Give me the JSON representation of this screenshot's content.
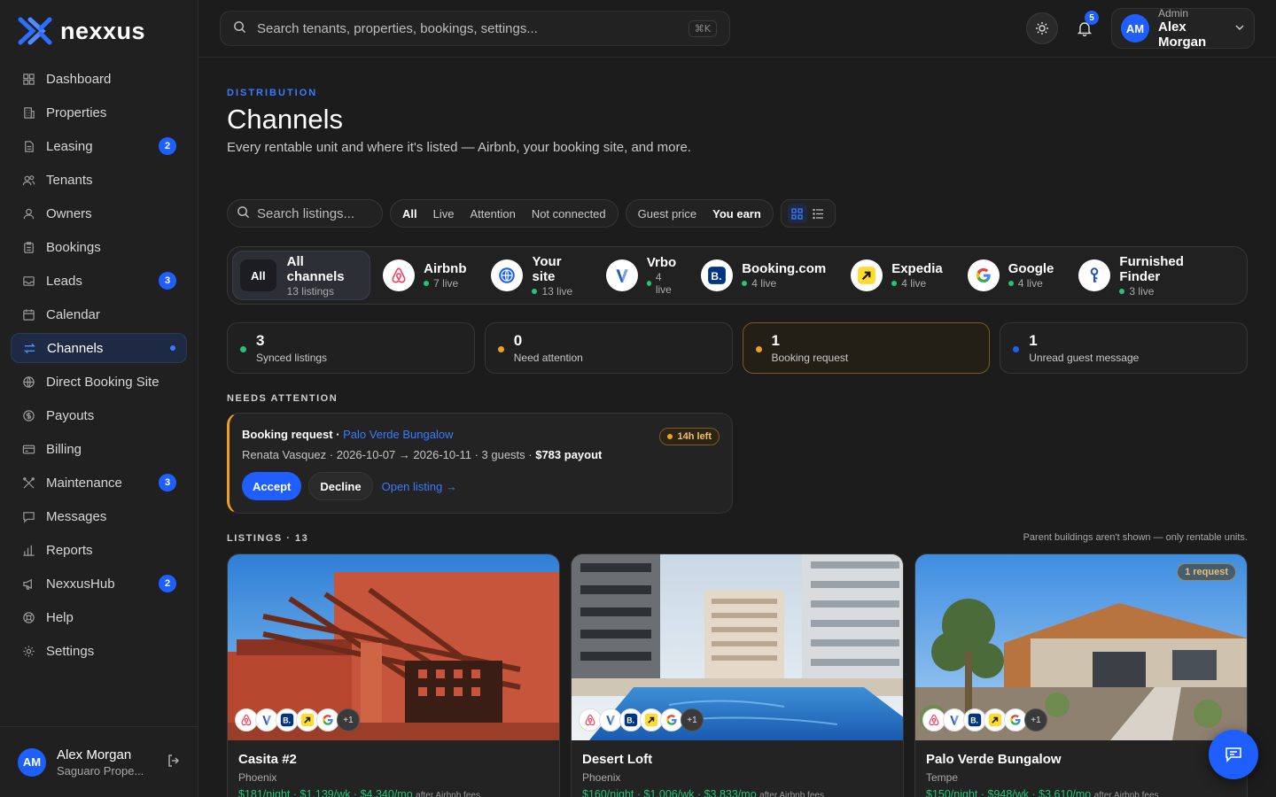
{
  "brand": {
    "name": "nexxus",
    "accent": "#1f5fff"
  },
  "sidebar": {
    "items": [
      {
        "label": "Dashboard",
        "icon": "grid-icon"
      },
      {
        "label": "Properties",
        "icon": "building-icon"
      },
      {
        "label": "Leasing",
        "icon": "document-icon",
        "badge": "2"
      },
      {
        "label": "Tenants",
        "icon": "users-icon"
      },
      {
        "label": "Owners",
        "icon": "user-icon"
      },
      {
        "label": "Bookings",
        "icon": "clipboard-icon"
      },
      {
        "label": "Leads",
        "icon": "inbox-icon",
        "badge": "3"
      },
      {
        "label": "Calendar",
        "icon": "calendar-icon"
      },
      {
        "label": "Channels",
        "icon": "arrows-icon",
        "active": true
      },
      {
        "label": "Direct Booking Site",
        "icon": "globe-icon"
      },
      {
        "label": "Payouts",
        "icon": "dollar-icon"
      },
      {
        "label": "Billing",
        "icon": "card-icon"
      },
      {
        "label": "Maintenance",
        "icon": "wrench-icon",
        "badge": "3"
      },
      {
        "label": "Messages",
        "icon": "chat-icon"
      },
      {
        "label": "Reports",
        "icon": "bar-chart-icon"
      },
      {
        "label": "NexxusHub",
        "icon": "megaphone-icon",
        "badge": "2"
      },
      {
        "label": "Help",
        "icon": "lifebuoy-icon"
      },
      {
        "label": "Settings",
        "icon": "gear-icon"
      }
    ],
    "user": {
      "initials": "AM",
      "name": "Alex Morgan",
      "org": "Saguaro Prope..."
    }
  },
  "topbar": {
    "search_placeholder": "Search tenants, properties, bookings, settings...",
    "shortcut": "⌘K",
    "notifications": "5",
    "user": {
      "initials": "AM",
      "role": "Admin",
      "name": "Alex Morgan"
    }
  },
  "page": {
    "eyebrow": "DISTRIBUTION",
    "title": "Channels",
    "subtitle": "Every rentable unit and where it's listed — Airbnb, your booking site, and more."
  },
  "toolbar": {
    "search_placeholder": "Search listings...",
    "filters": [
      "All",
      "Live",
      "Attention",
      "Not connected"
    ],
    "active_filter": "All",
    "price_modes": [
      "Guest price",
      "You earn"
    ],
    "active_price_mode": "You earn"
  },
  "channels": {
    "all": {
      "pill": "All",
      "name": "All channels",
      "sub": "13 listings"
    },
    "items": [
      {
        "name": "Airbnb",
        "sub": "7 live",
        "icon": "airbnb-icon"
      },
      {
        "name": "Your site",
        "sub": "13 live",
        "icon": "globe-icon"
      },
      {
        "name": "Vrbo",
        "sub": "4 live",
        "icon": "vrbo-icon"
      },
      {
        "name": "Booking.com",
        "sub": "4 live",
        "icon": "booking-icon"
      },
      {
        "name": "Expedia",
        "sub": "4 live",
        "icon": "expedia-icon"
      },
      {
        "name": "Google",
        "sub": "4 live",
        "icon": "google-icon"
      },
      {
        "name": "Furnished Finder",
        "sub": "3 live",
        "icon": "furnished-finder-icon"
      }
    ]
  },
  "stats": [
    {
      "value": "3",
      "label": "Synced listings",
      "color": "#27c27a"
    },
    {
      "value": "0",
      "label": "Need attention",
      "color": "#f0a020"
    },
    {
      "value": "1",
      "label": "Booking request",
      "color": "#f0a020"
    },
    {
      "value": "1",
      "label": "Unread guest message",
      "color": "#1f5fff"
    }
  ],
  "needs_attention": {
    "label": "NEEDS ATTENTION",
    "card": {
      "type": "Booking request",
      "separator": " · ",
      "property": "Palo Verde Bungalow",
      "time_left": "14h left",
      "details": "Renata Vasquez · 2026-10-07 → 2026-10-11 · 3 guests · ",
      "payout": "$783 payout",
      "accept": "Accept",
      "decline": "Decline",
      "open": "Open listing →"
    }
  },
  "listings": {
    "label": "LISTINGS · 13",
    "note": "Parent buildings aren't shown — only rentable units.",
    "items": [
      {
        "name": "Casita #2",
        "city": "Phoenix",
        "price": "$181/night · $1,139/wk · $4,340/mo",
        "fees": "after Airbnb fees",
        "more": "+1"
      },
      {
        "name": "Desert Loft",
        "city": "Phoenix",
        "price": "$160/night · $1,006/wk · $3,833/mo",
        "fees": "after Airbnb fees",
        "more": "+1"
      },
      {
        "name": "Palo Verde Bungalow",
        "city": "Tempe",
        "price": "$150/night · $948/wk · $3,610/mo",
        "fees": "after Airbnb fees",
        "more": "+1",
        "badge": "1 request"
      }
    ]
  }
}
